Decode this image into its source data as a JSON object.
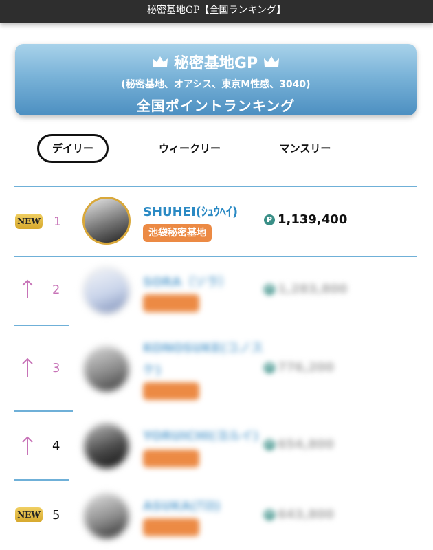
{
  "header": {
    "title": "秘密基地GP【全国ランキング】"
  },
  "banner": {
    "title": "秘密基地GP",
    "subtitle": "(秘密基地、オアシス、東京M性感、3040)",
    "heading": "全国ポイントランキング"
  },
  "tabs": [
    {
      "label": "デイリー",
      "active": true
    },
    {
      "label": "ウィークリー",
      "active": false
    },
    {
      "label": "マンスリー",
      "active": false
    }
  ],
  "rankings": [
    {
      "rank": "1",
      "badge": "NEW",
      "name": "SHUHEI(ｼｭｳﾍｲ)",
      "shop": "池袋秘密基地",
      "points": "1,139,400"
    },
    {
      "rank": "2",
      "badge": "",
      "name": "SORA（ソラ）",
      "shop": "",
      "points": "1,283,800"
    },
    {
      "rank": "3",
      "badge": "",
      "name": "KONOSUKE(コノス",
      "name_line2": "ケ)",
      "shop": "",
      "points": "776,200"
    },
    {
      "rank": "4",
      "badge": "",
      "name": "YORUICHI(ヨルイ)",
      "shop": "",
      "points": "654,800"
    },
    {
      "rank": "5",
      "badge": "NEW",
      "name": "ASUKA(ｱｽｶ)",
      "shop": "",
      "points": "643,800"
    }
  ],
  "colors": {
    "accent": "#2b8ac4",
    "rank_pink": "#c773b7",
    "tag_orange": "#ec8a44",
    "badge_gold": "#d6a82c"
  }
}
